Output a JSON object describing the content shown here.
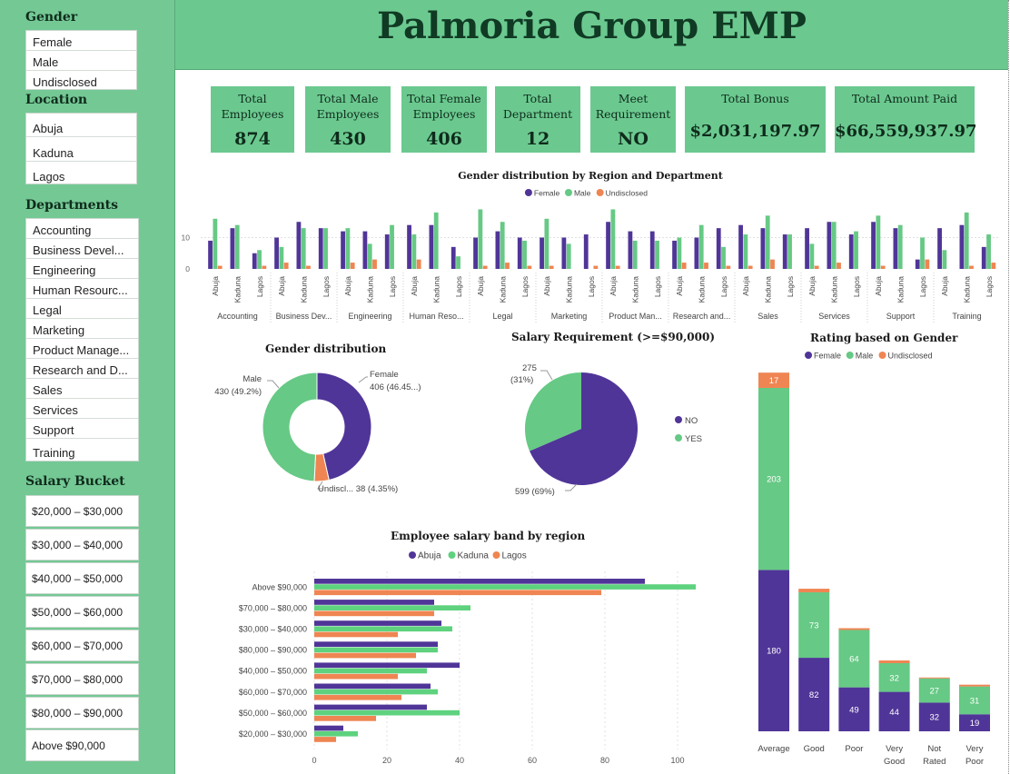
{
  "colors": {
    "female": "#503598",
    "male": "#66c985",
    "undisclosed": "#ef8552",
    "abuja": "#503598",
    "kaduna": "#5ed27e",
    "lagos": "#ef8552",
    "no": "#503598",
    "yes": "#66c985"
  },
  "sidebar": {
    "gender": {
      "title": "Gender",
      "items": [
        "Female",
        "Male",
        "Undisclosed"
      ]
    },
    "location": {
      "title": "Location",
      "items": [
        "Abuja",
        "Kaduna",
        "Lagos"
      ]
    },
    "departments": {
      "title": "Departments",
      "items": [
        "Accounting",
        "Business Devel...",
        "Engineering",
        "Human Resourc...",
        "Legal",
        "Marketing",
        "Product Manage...",
        "Research and D...",
        "Sales",
        "Services",
        "Support",
        "Training"
      ]
    },
    "salary": {
      "title": "Salary Bucket",
      "items": [
        "$20,000 – $30,000",
        "$30,000 – $40,000",
        "$40,000 – $50,000",
        "$50,000 – $60,000",
        "$60,000 – $70,000",
        "$70,000 – $80,000",
        "$80,000 – $90,000",
        "Above $90,000"
      ]
    }
  },
  "header": {
    "title": "Palmoria Group EMP"
  },
  "kpis": [
    {
      "label": "Total Employees",
      "value": "874"
    },
    {
      "label": "Total Male Employees",
      "value": "430"
    },
    {
      "label": "Total Female Employees",
      "value": "406"
    },
    {
      "label": "Total Department",
      "value": "12"
    },
    {
      "label": "Meet Requirement",
      "value": "NO"
    },
    {
      "label": "Total Bonus",
      "value": "$2,031,197.97"
    },
    {
      "label": "Total Amount Paid",
      "value": "$66,559,937.97"
    }
  ],
  "chart_data": [
    {
      "type": "bar",
      "title": "Gender distribution by Region and Department",
      "legend": [
        "Female",
        "Male",
        "Undisclosed"
      ],
      "legend_position": "top-center",
      "ylim": [
        0,
        25
      ],
      "yticks": [
        "0",
        "10"
      ],
      "departments": [
        "Accounting",
        "Business Dev...",
        "Engineering",
        "Human Reso...",
        "Legal",
        "Marketing",
        "Product Man...",
        "Research and...",
        "Sales",
        "Services",
        "Support",
        "Training"
      ],
      "regions": [
        "Abuja",
        "Kaduna",
        "Lagos"
      ],
      "series": [
        {
          "name": "Female",
          "values": [
            9,
            13,
            5,
            10,
            15,
            13,
            12,
            12,
            11,
            14,
            14,
            7,
            10,
            12,
            10,
            10,
            10,
            11,
            15,
            12,
            12,
            9,
            10,
            13,
            14,
            13,
            11,
            13,
            15,
            11,
            15,
            13,
            3,
            13,
            14,
            7
          ]
        },
        {
          "name": "Male",
          "values": [
            16,
            14,
            6,
            7,
            13,
            13,
            13,
            8,
            14,
            11,
            18,
            4,
            19,
            15,
            9,
            16,
            8,
            0,
            19,
            9,
            9,
            10,
            14,
            7,
            11,
            17,
            11,
            8,
            15,
            12,
            17,
            14,
            10,
            6,
            18,
            11
          ]
        },
        {
          "name": "Undisclosed",
          "values": [
            1,
            0,
            1,
            2,
            1,
            0,
            2,
            3,
            0,
            3,
            0,
            0,
            1,
            2,
            1,
            1,
            0,
            1,
            1,
            0,
            0,
            2,
            2,
            1,
            1,
            3,
            0,
            1,
            2,
            0,
            1,
            0,
            3,
            0,
            1,
            2
          ]
        }
      ]
    },
    {
      "type": "pie",
      "title": "Gender distribution",
      "donut": true,
      "slices": [
        {
          "name": "Female",
          "value": 406,
          "label": "Female\n406 (46.45...)"
        },
        {
          "name": "Undisclosed",
          "value": 38,
          "label": "Undiscl... 38 (4.35%)"
        },
        {
          "name": "Male",
          "value": 430,
          "label": "Male\n430 (49.2%)"
        }
      ]
    },
    {
      "type": "pie",
      "title": "Salary Requirement (>=$90,000)",
      "legend": [
        "NO",
        "YES"
      ],
      "legend_position": "right",
      "slices": [
        {
          "name": "NO",
          "value": 599,
          "label": "599 (69%)"
        },
        {
          "name": "YES",
          "value": 275,
          "label": "275\n(31%)"
        }
      ]
    },
    {
      "type": "bar",
      "orientation": "horizontal",
      "title": "Employee salary band by region",
      "legend": [
        "Abuja",
        "Kaduna",
        "Lagos"
      ],
      "legend_position": "top-center",
      "categories": [
        "Above $90,000",
        "$70,000 – $80,000",
        "$30,000 – $40,000",
        "$80,000 – $90,000",
        "$40,000 – $50,000",
        "$60,000 – $70,000",
        "$50,000 – $60,000",
        "$20,000 – $30,000"
      ],
      "xlim": [
        0,
        110
      ],
      "xticks": [
        0,
        20,
        40,
        60,
        80,
        100
      ],
      "series": [
        {
          "name": "Abuja",
          "values": [
            91,
            33,
            35,
            34,
            40,
            32,
            31,
            8
          ]
        },
        {
          "name": "Kaduna",
          "values": [
            105,
            43,
            38,
            34,
            31,
            34,
            40,
            12
          ]
        },
        {
          "name": "Lagos",
          "values": [
            79,
            33,
            23,
            28,
            23,
            24,
            17,
            6
          ]
        }
      ]
    },
    {
      "type": "bar",
      "stacked": true,
      "title": "Rating based on Gender",
      "legend": [
        "Female",
        "Male",
        "Undisclosed"
      ],
      "legend_position": "top-center",
      "categories": [
        "Average",
        "Good",
        "Poor",
        "Very Good",
        "Not Rated",
        "Very Poor"
      ],
      "series": [
        {
          "name": "Female",
          "values": [
            180,
            82,
            49,
            44,
            32,
            19
          ],
          "labels": [
            "180",
            "82",
            "49",
            "44",
            "32",
            "19"
          ]
        },
        {
          "name": "Male",
          "values": [
            203,
            73,
            64,
            32,
            27,
            31
          ],
          "labels": [
            "203",
            "73",
            "64",
            "32",
            "27",
            "31"
          ]
        },
        {
          "name": "Undisclosed",
          "values": [
            17,
            4,
            2,
            3,
            1,
            2
          ],
          "labels": [
            "17",
            "",
            "",
            "",
            "",
            ""
          ]
        }
      ]
    }
  ]
}
